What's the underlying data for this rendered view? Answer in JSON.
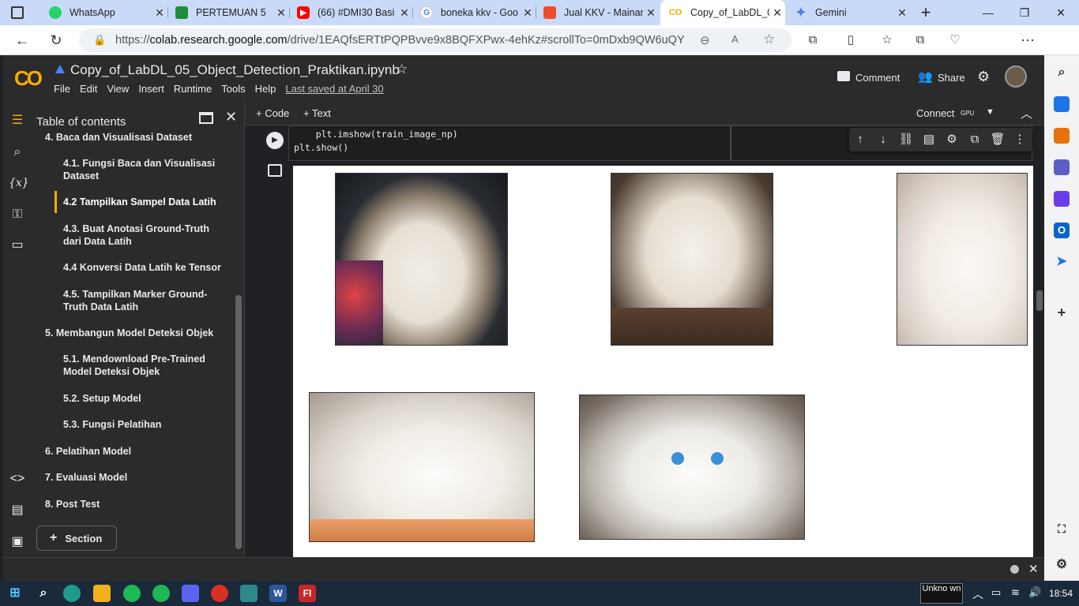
{
  "browser": {
    "tabs": [
      {
        "title": "WhatsApp",
        "icon": "whatsapp-icon",
        "color": "#25d366"
      },
      {
        "title": "PERTEMUAN 5",
        "icon": "classroom-icon",
        "color": "#1e8e3e"
      },
      {
        "title": "(66) #DMI30 Basi",
        "icon": "youtube-icon",
        "color": "#ff0000"
      },
      {
        "title": "boneka kkv - Goo",
        "icon": "google-icon",
        "color": "#4285f4"
      },
      {
        "title": "Jual KKV - Mainan",
        "icon": "shopee-icon",
        "color": "#ee4d2d"
      },
      {
        "title": "Copy_of_LabDL_0",
        "icon": "colab-icon",
        "color": "#f9ab00"
      },
      {
        "title": "Gemini",
        "icon": "gemini-icon",
        "color": "#4b7bec"
      }
    ],
    "url_prefix": "https://",
    "url_domain": "colab.research.google.com",
    "url_path": "/drive/1EAQfsERTtPQPBvve9x8BQFXPwx-4ehKz#scrollTo=0mDxb9QW6uQY"
  },
  "colab": {
    "title": "Copy_of_LabDL_05_Object_Detection_Praktikan.ipynb",
    "menu": [
      "File",
      "Edit",
      "View",
      "Insert",
      "Runtime",
      "Tools",
      "Help"
    ],
    "last_saved": "Last saved at April 30",
    "comment": "Comment",
    "share": "Share",
    "add_code": "+ Code",
    "add_text": "+ Text",
    "connect": "Connect",
    "gpu": "GPU"
  },
  "toc": {
    "header": "Table of contents",
    "items": [
      {
        "label": "4. Baca dan Visualisasi Dataset",
        "level": 1
      },
      {
        "label": "4.1. Fungsi Baca dan Visualisasi Dataset",
        "level": 2
      },
      {
        "label": "4.2 Tampilkan Sampel Data Latih",
        "level": 2,
        "active": true
      },
      {
        "label": "4.3. Buat Anotasi Ground-Truth dari Data Latih",
        "level": 2
      },
      {
        "label": "4.4 Konversi Data Latih ke Tensor",
        "level": 2
      },
      {
        "label": "4.5. Tampilkan Marker Ground-Truth Data Latih",
        "level": 2
      },
      {
        "label": "5. Membangun Model Deteksi Objek",
        "level": 1
      },
      {
        "label": "5.1. Mendownload Pre-Trained Model Deteksi Objek",
        "level": 2
      },
      {
        "label": "5.2. Setup Model",
        "level": 2
      },
      {
        "label": "5.3. Fungsi Pelatihan",
        "level": 2
      },
      {
        "label": "6. Pelatihan Model",
        "level": 1
      },
      {
        "label": "7. Evaluasi Model",
        "level": 1
      },
      {
        "label": "8. Post Test",
        "level": 1
      }
    ],
    "section_button": "Section"
  },
  "cell": {
    "line1": "    plt.imshow(train_image_np)",
    "line2": "plt.show()"
  },
  "taskbar": {
    "weather": "Unkno wn",
    "time": "18:54"
  }
}
